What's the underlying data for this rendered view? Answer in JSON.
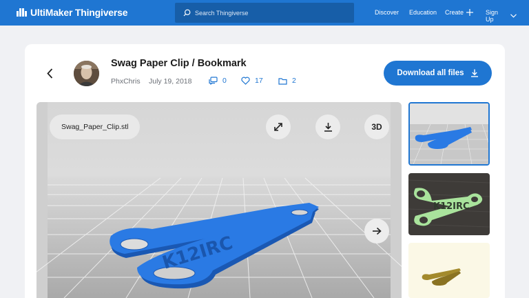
{
  "header": {
    "brand": "UltiMaker Thingiverse",
    "search_placeholder": "Search Thingiverse",
    "nav": {
      "discover": "Discover",
      "education": "Education",
      "create": "Create",
      "signup": "Sign Up"
    }
  },
  "thing": {
    "title": "Swag Paper Clip / Bookmark",
    "author": "PhxChris",
    "date": "July 19, 2018",
    "comments": "0",
    "likes": "17",
    "collections": "2",
    "download_all_label": "Download all files"
  },
  "viewer": {
    "file_name": "Swag_Paper_Clip.stl",
    "btn_3d_label": "3D",
    "model_text": "K12IRC"
  },
  "thumbnails": [
    {
      "kind": "render-blue",
      "selected": true
    },
    {
      "kind": "photo-green",
      "text": "K12IRC"
    },
    {
      "kind": "render-gold"
    }
  ],
  "colors": {
    "brand_blue": "#1f76d2",
    "model_blue": "#2a7ae4",
    "print_green": "#a9e39c"
  }
}
